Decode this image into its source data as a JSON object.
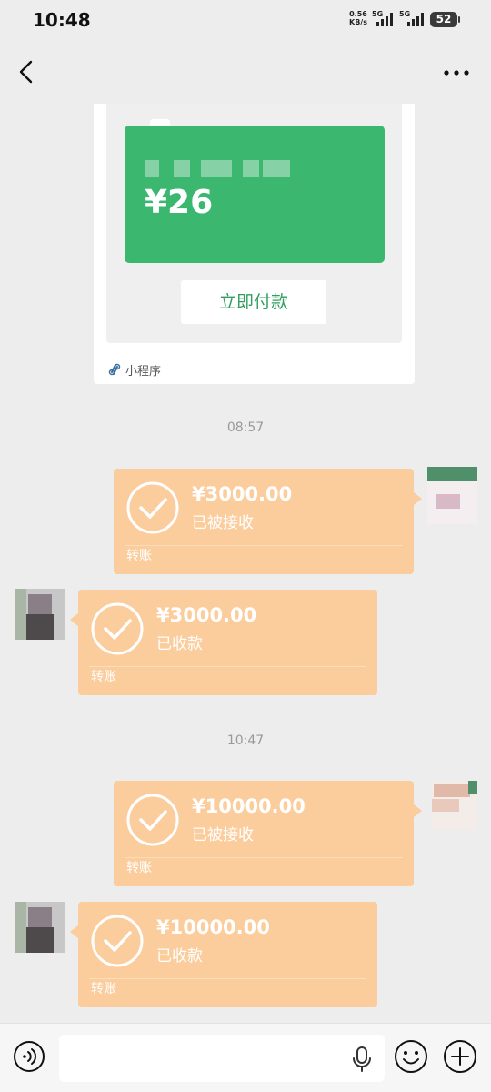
{
  "status_bar": {
    "time": "10:48",
    "net_speed_value": "0.56",
    "net_speed_unit": "KB/s",
    "network_1": "5G",
    "network_2": "5G",
    "battery": "52"
  },
  "mini_program": {
    "amount": "¥26",
    "pay_button": "立即付款",
    "label": "小程序",
    "accent_color": "#3cb770"
  },
  "messages": [
    {
      "type": "timestamp",
      "text": "08:57"
    },
    {
      "type": "transfer",
      "side": "right",
      "amount": "¥3000.00",
      "status": "已被接收",
      "label": "转账"
    },
    {
      "type": "transfer",
      "side": "left",
      "amount": "¥3000.00",
      "status": "已收款",
      "label": "转账"
    },
    {
      "type": "timestamp",
      "text": "10:47"
    },
    {
      "type": "transfer",
      "side": "right",
      "amount": "¥10000.00",
      "status": "已被接收",
      "label": "转账"
    },
    {
      "type": "transfer",
      "side": "left",
      "amount": "¥10000.00",
      "status": "已收款",
      "label": "转账"
    }
  ],
  "input_bar": {
    "icons": [
      "voice-icon",
      "mic-icon",
      "emoji-icon",
      "plus-icon"
    ]
  },
  "colors": {
    "transfer_bubble": "#fbcd9d",
    "background": "#ededed"
  }
}
